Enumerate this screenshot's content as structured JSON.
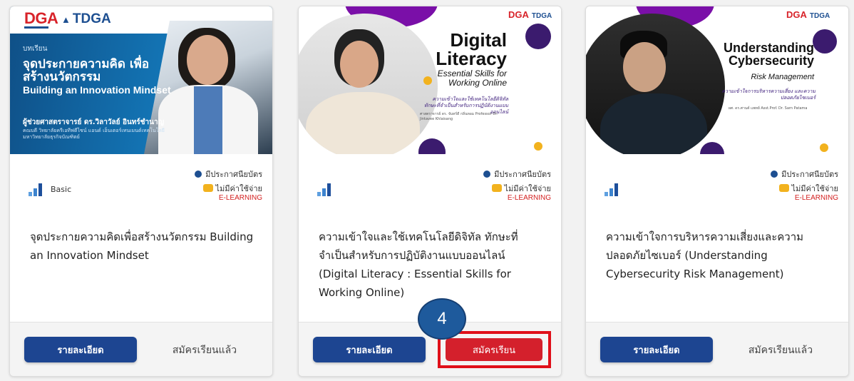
{
  "courses": [
    {
      "banner": {
        "logo_main": "DGA",
        "logo_sub": "TDGA",
        "tag": "บทเรียน",
        "title_th": "จุดประกายความคิด เพื่อสร้างนวัตกรรม",
        "title_en": "Building an Innovation Mindset",
        "author": "ผู้ช่วยศาสตราจารย์ ดร.วิลาวัลย์ อินทร์ชำนาญ",
        "author_detail": "คณบดี วิทยาลัยครีเอทีฟดีไซน์ แอนด์ เอ็นเตอร์เทนเมนต์เทคโนโลยี มหาวิทยาลัยธุรกิจบัณฑิตย์"
      },
      "level": "Basic",
      "certificate": "มีประกาศนียบัตร",
      "fee": "ไม่มีค่าใช้จ่าย",
      "type": "E-LEARNING",
      "title": "จุดประกายความคิดเพื่อสร้างนวัตกรรม Building an Innovation Mindset",
      "detail_button": "รายละเอียด",
      "status": "สมัครเรียนแล้ว"
    },
    {
      "banner": {
        "logo_main": "DGA",
        "logo_sub": "TDGA",
        "title_en": "Digital Literacy",
        "subtitle_en": "Essential Skills for Working Online",
        "title_th": "ความเข้าใจและใช้เทคโนโลยีดิจิทัล ทักษะที่จำเป็นสำหรับการปฏิบัติงานแบบออนไลน์",
        "mini": "ศาสตราจารย์ ดร. จันทร์ดี กลิ่นหอม Professor Dr. Jintavee Khlaisang"
      },
      "level": "",
      "certificate": "มีประกาศนียบัตร",
      "fee": "ไม่มีค่าใช้จ่าย",
      "type": "E-LEARNING",
      "title": "ความเข้าใจและใช้เทคโนโลยีดิจิทัล ทักษะที่จำเป็นสำหรับการปฏิบัติงานแบบออนไลน์ (Digital Literacy : Essential Skills for Working Online)",
      "detail_button": "รายละเอียด",
      "enroll_button": "สมัครเรียน"
    },
    {
      "banner": {
        "logo_main": "DGA",
        "logo_sub": "TDGA",
        "title_en": "Understanding Cybersecurity",
        "subtitle_en": "Risk Management",
        "title_th": "ความเข้าใจการบริหารความเสี่ยง และความปลอดภัยไซเบอร์",
        "mini": "ผศ. ดร.ศานต์ แพทย์ Asst.Prof. Dr. Sarn Patama"
      },
      "level": "",
      "certificate": "มีประกาศนียบัตร",
      "fee": "ไม่มีค่าใช้จ่าย",
      "type": "E-LEARNING",
      "title": "ความเข้าใจการบริหารความเสี่ยงและความปลอดภัยไซเบอร์ (Understanding Cybersecurity Risk Management)",
      "detail_button": "รายละเอียด",
      "status": "สมัครเรียนแล้ว"
    }
  ],
  "annotation": {
    "step_number": "4"
  },
  "colors": {
    "primary_button": "#1d4591",
    "enroll_button": "#d4202c",
    "highlight_box": "#e0101a",
    "step_badge": "#1e5a9c",
    "e_learning_label": "#d32020"
  }
}
